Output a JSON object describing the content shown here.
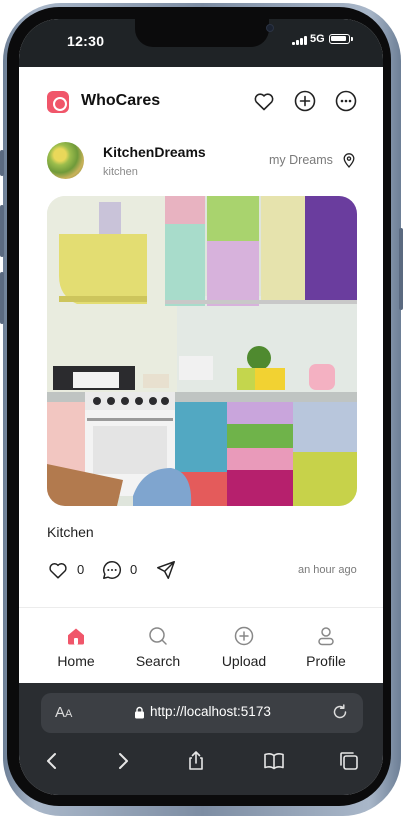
{
  "status": {
    "time": "12:30",
    "network": "5G"
  },
  "app": {
    "name": "WhoCares"
  },
  "header_icons": [
    "heart-icon",
    "plus-circle-icon",
    "more-icon"
  ],
  "post": {
    "username": "KitchenDreams",
    "subtitle": "kitchen",
    "location": "my Dreams",
    "caption": "Kitchen",
    "likes": "0",
    "comments": "0",
    "time_ago": "an hour ago"
  },
  "nav": {
    "items": [
      {
        "label": "Home",
        "icon": "home-icon",
        "active": true
      },
      {
        "label": "Search",
        "icon": "search-icon",
        "active": false
      },
      {
        "label": "Upload",
        "icon": "upload-icon",
        "active": false
      },
      {
        "label": "Profile",
        "icon": "profile-icon",
        "active": false
      }
    ]
  },
  "browser": {
    "aa_big": "A",
    "aa_small": "A",
    "url": "http://localhost:5173"
  },
  "colors": {
    "accent": "#f0566a",
    "browser_bg": "#2a2d31",
    "status_bg": "#1f2326"
  }
}
